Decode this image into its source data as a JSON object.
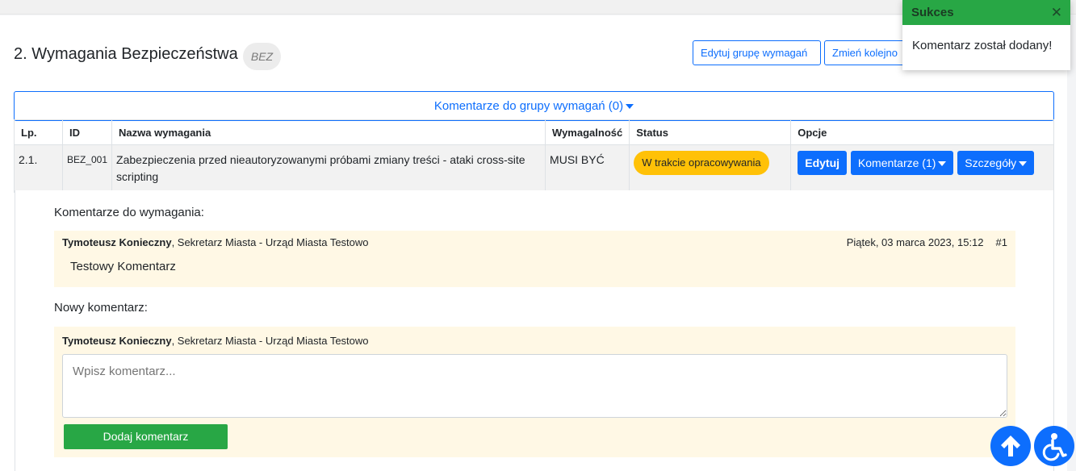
{
  "group": {
    "title": "2. Wymagania Bezpieczeństwa",
    "code": "BEZ",
    "edit_group_label": "Edytuj grupę wymagań",
    "reorder_label": "Zmień kolejno",
    "comments_toggle": "Komentarze do grupy wymagań (0)"
  },
  "table": {
    "headers": [
      "Lp.",
      "ID",
      "Nazwa wymagania",
      "Wymagalność",
      "Status",
      "Opcje"
    ],
    "rows": [
      {
        "lp": "2.1.",
        "id": "BEZ_001",
        "name": "Zabezpieczenia przed nieautoryzowanymi próbami zmiany treści - ataki cross-site scripting",
        "requirement_level": "MUSI BYĆ",
        "status": "W trakcie opracowywania",
        "edit_label": "Edytuj",
        "comments_label": "Komentarze (1)",
        "details_label": "Szczegóły"
      }
    ]
  },
  "details": {
    "comments_heading": "Komentarze do wymagania:",
    "comments": [
      {
        "author_name": "Tymoteusz Konieczny",
        "author_role": ", Sekretarz Miasta - Urząd Miasta Testowo",
        "date": "Piątek, 03 marca 2023, 15:12",
        "number": "#1",
        "text": "Testowy Komentarz"
      }
    ],
    "new_comment_heading": "Nowy komentarz:",
    "new_comment": {
      "author_name": "Tymoteusz Konieczny",
      "author_role": ", Sekretarz Miasta - Urząd Miasta Testowo",
      "placeholder": "Wpisz komentarz...",
      "submit_label": "Dodaj komentarz"
    }
  },
  "toast": {
    "title": "Sukces",
    "close": "✕",
    "message": "Komentarz został dodany!"
  },
  "colors": {
    "primary": "#0d6efd",
    "success": "#28a745",
    "warning": "#ffc107",
    "comment_bg": "#fff8e5"
  },
  "icons": {
    "scroll_top": "arrow-up-icon",
    "accessibility": "wheelchair-icon"
  }
}
